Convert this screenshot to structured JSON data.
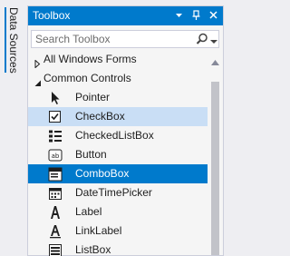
{
  "side_tab": {
    "label": "Data Sources"
  },
  "toolbox": {
    "title": "Toolbox",
    "search": {
      "placeholder": "Search Toolbox",
      "value": ""
    },
    "groups": [
      {
        "label": "All Windows Forms",
        "expanded": false
      },
      {
        "label": "Common Controls",
        "expanded": true
      }
    ],
    "items": [
      {
        "label": "Pointer",
        "icon": "pointer-icon"
      },
      {
        "label": "CheckBox",
        "icon": "checkbox-icon",
        "state": "hover"
      },
      {
        "label": "CheckedListBox",
        "icon": "checkedlistbox-icon"
      },
      {
        "label": "Button",
        "icon": "button-icon"
      },
      {
        "label": "ComboBox",
        "icon": "combobox-icon",
        "state": "selected"
      },
      {
        "label": "DateTimePicker",
        "icon": "datetimepicker-icon"
      },
      {
        "label": "Label",
        "icon": "label-icon"
      },
      {
        "label": "LinkLabel",
        "icon": "linklabel-icon"
      },
      {
        "label": "ListBox",
        "icon": "listbox-icon"
      }
    ]
  },
  "colors": {
    "accent": "#007acc",
    "hover": "#c9def5",
    "panel": "#f5f5f5",
    "background": "#eeeef2"
  }
}
